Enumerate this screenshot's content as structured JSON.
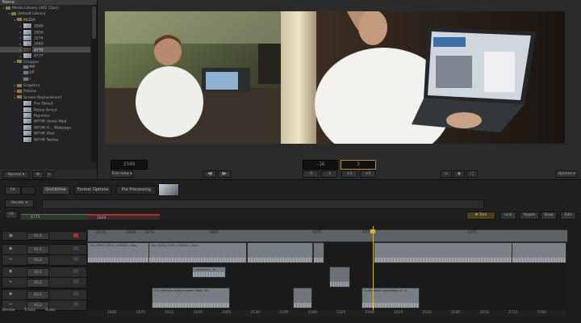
{
  "library": {
    "header": "Name",
    "rows": [
      {
        "label": "Media Library (462 Clips)",
        "indent": 0,
        "tri": "▾",
        "icon": "folder"
      },
      {
        "label": "Default Library",
        "indent": 1,
        "tri": "▾",
        "icon": "folder"
      },
      {
        "label": "MEDIA",
        "indent": 2,
        "tri": "▾",
        "icon": "folder"
      },
      {
        "label": "2849",
        "indent": 3,
        "tri": "▸",
        "icon": "thumb"
      },
      {
        "label": "2856",
        "indent": 3,
        "tri": "▸",
        "icon": "thumb"
      },
      {
        "label": "3274",
        "indent": 3,
        "tri": "▸",
        "icon": "thumb"
      },
      {
        "label": "2880",
        "indent": 3,
        "tri": "▸",
        "icon": "thumb"
      },
      {
        "label": "4775",
        "indent": 3,
        "tri": "▸",
        "icon": "thumb-dark",
        "selected": true
      },
      {
        "label": "4777",
        "indent": 3,
        "tri": "▸",
        "icon": "thumb"
      },
      {
        "label": "Chopper",
        "indent": 2,
        "tri": "▾",
        "icon": "folder"
      },
      {
        "label": "880MP",
        "indent": 3,
        "tri": "",
        "icon": "clip"
      },
      {
        "label": "8802P",
        "indent": 3,
        "tri": "",
        "icon": "clip"
      },
      {
        "label": "Solo",
        "indent": 3,
        "tri": "",
        "icon": "clip"
      },
      {
        "label": "Graphics",
        "indent": 2,
        "tri": "▸",
        "icon": "folder"
      },
      {
        "label": "Proxies",
        "indent": 2,
        "tri": "▸",
        "icon": "folder"
      },
      {
        "label": "Screen Replacement",
        "indent": 2,
        "tri": "▾",
        "icon": "folder"
      },
      {
        "label": "Fire Street",
        "indent": 3,
        "tri": "",
        "icon": "thumb"
      },
      {
        "label": "Police Arrest",
        "indent": 3,
        "tri": "",
        "icon": "thumb"
      },
      {
        "label": "Reporter",
        "indent": 3,
        "tri": "",
        "icon": "thumb"
      },
      {
        "label": "WTHR Home Web",
        "indent": 3,
        "tri": "",
        "icon": "thumb"
      },
      {
        "label": "WTHR H... Webpage",
        "indent": 3,
        "tri": "",
        "icon": "thumb"
      },
      {
        "label": "WTHR iPad",
        "indent": 3,
        "tri": "",
        "icon": "thumb"
      },
      {
        "label": "WTHR Twitter",
        "indent": 3,
        "tri": "",
        "icon": "thumb"
      }
    ],
    "view_mode": "Normal"
  },
  "viewer": {
    "timecode_left": "2349",
    "tc_offset": "-16",
    "tc_frames": "3",
    "trim_mode": "Trim View",
    "step_buttons": [
      "-5",
      "-1",
      "+1",
      "+5"
    ],
    "options_label": "Options"
  },
  "middle": {
    "tabs": [
      "Quicktime",
      "Format Options",
      "Pre Processing"
    ],
    "fx_label": "FX",
    "render_label": "Render",
    "marker_label": "4775",
    "marker2_label": "2849"
  },
  "timeline": {
    "toolbar": [
      "Trim",
      "Link",
      "Ripple",
      "Snap",
      "Edit"
    ],
    "ruler_ticks": [
      "2874",
      "2856",
      "3274",
      "2880",
      "4775",
      "4777",
      "4775"
    ],
    "ruler_ticks_bottom": [
      "1805",
      "1870",
      "1935",
      "2000",
      "2065",
      "2130",
      "2195",
      "2260",
      "2325",
      "2390",
      "2455",
      "2520",
      "2585",
      "2650",
      "2715",
      "2780"
    ],
    "tracks": [
      {
        "id": "V1.1",
        "name": "V1.1"
      },
      {
        "id": "A1.1",
        "name": "A1.1"
      },
      {
        "id": "A1.2",
        "name": "A1.2"
      },
      {
        "id": "A2.1",
        "name": "A2.1"
      },
      {
        "id": "A2.2",
        "name": "A2.2"
      },
      {
        "id": "A3.1",
        "name": "A3.1"
      },
      {
        "id": "A3.2",
        "name": "A3.2"
      }
    ],
    "clip_labels": {
      "a1": "clip_A052_C003_1202X0...mov",
      "a2": "clip_A052_C004_1202X0...mov",
      "music1": "Universal....rk",
      "music2": "01 Clientone Independent Mixe: Dr...",
      "music3": "01 Clientone Independent Mixe: Dr...",
      "vo": "cv Ny store sundstate v0...s"
    },
    "bottom_tabs": [
      "Version",
      "Tracks",
      "Audio"
    ]
  }
}
